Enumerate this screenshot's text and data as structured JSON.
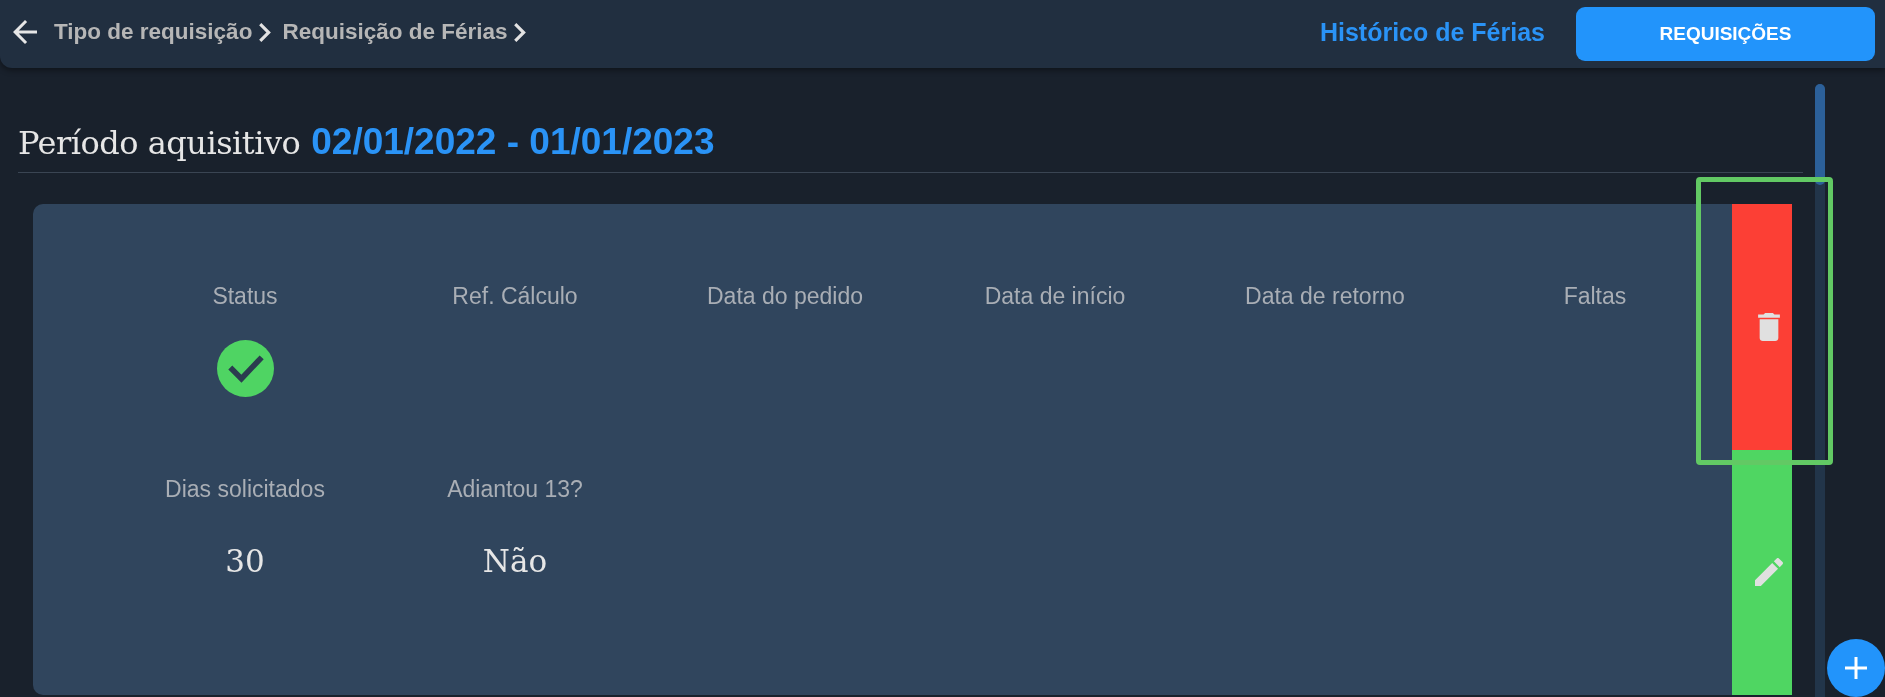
{
  "top_bar": {
    "breadcrumb": [
      "Tipo de requisição",
      "Requisição de Férias"
    ],
    "link": "Histórico de Férias",
    "button": "REQUISIÇÕES"
  },
  "period": {
    "label": "Período aquisitivo",
    "range": "02/01/2022 - 01/01/2023"
  },
  "card": {
    "fields": [
      {
        "label": "Status",
        "kind": "status",
        "approved": true
      },
      {
        "label": "Ref. Cálculo",
        "kind": "text"
      },
      {
        "label": "Data do pedido",
        "kind": "text"
      },
      {
        "label": "Data de início",
        "kind": "text"
      },
      {
        "label": "Data de retorno",
        "kind": "text"
      },
      {
        "label": "Faltas",
        "kind": "text"
      },
      {
        "label": "Dias solicitados",
        "kind": "text",
        "value": "30"
      },
      {
        "label": "Adiantou 13?",
        "kind": "text",
        "value": "Não"
      }
    ],
    "actions": [
      {
        "kind": "delete",
        "highlighted": true
      },
      {
        "kind": "edit",
        "highlighted": false
      }
    ]
  }
}
